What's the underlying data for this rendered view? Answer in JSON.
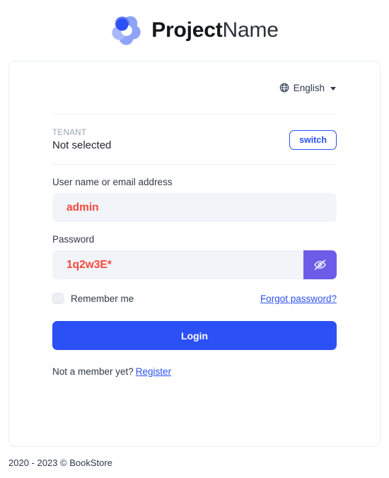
{
  "brand": {
    "name_bold": "Project",
    "name_light": "Name",
    "logo_icon": "pinwheel-logo-icon",
    "logo_colors": [
      "#2b50f6",
      "#5b78f7",
      "#8fa3f9",
      "#a9b8fb"
    ]
  },
  "language": {
    "icon": "globe-icon",
    "selected": "English",
    "caret_icon": "chevron-down-icon"
  },
  "tenant": {
    "label": "TENANT",
    "value": "Not selected",
    "switch_label": "switch"
  },
  "form": {
    "username": {
      "label": "User name or email address",
      "value": "admin",
      "placeholder": ""
    },
    "password": {
      "label": "Password",
      "value": "1q2w3E*",
      "placeholder": "",
      "toggle_icon": "eye-slash-icon"
    },
    "remember_me": {
      "label": "Remember me",
      "checked": false
    },
    "forgot_password_label": "Forgot password?",
    "login_label": "Login"
  },
  "signup": {
    "prompt": "Not a member yet?",
    "link_label": "Register"
  },
  "footer": {
    "text": "2020 - 2023 © BookStore"
  },
  "colors": {
    "primary": "#2b50f6",
    "input_text": "#f5483b",
    "input_bg": "#f1f4f8",
    "eye_button": "#6c5ce7",
    "card_border": "#e7edf4"
  }
}
